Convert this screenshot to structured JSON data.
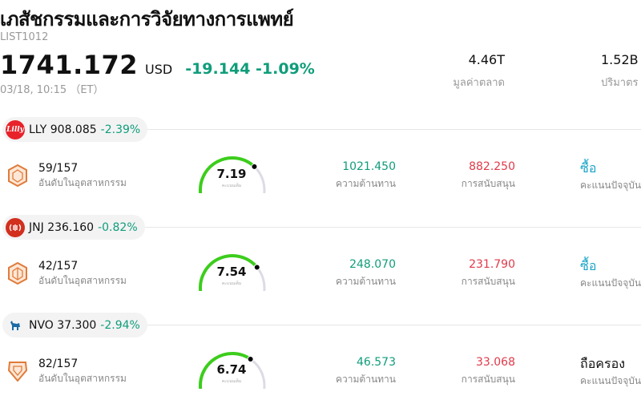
{
  "header": {
    "title": "เภสัชกรรมและการวิจัยทางการแพทย์",
    "code": "LIST1012",
    "price": "1741.172",
    "currency": "USD",
    "change": "-19.144 -1.09%",
    "timestamp": "03/18, 10:15 （ET）"
  },
  "stats": {
    "market_cap_value": "4.46T",
    "market_cap_label": "มูลค่าตลาด",
    "volume_value": "1.52B",
    "volume_label": "ปริมาตร"
  },
  "colors": {
    "positive_accent": "#0f9d7a",
    "support_red": "#e03a4a",
    "buy_cyan": "#1aa4c8",
    "gauge_green": "#3ccd1c",
    "gauge_track": "#dcdce6",
    "badge_orange": "#e07b39"
  },
  "labels": {
    "rank_label": "อันดับในอุตสาหกรรม",
    "gauge_label": "คะแนนเต็ม",
    "resistance_label": "ความต้านทาน",
    "support_label": "การสนับสนุน",
    "rating_label": "คะแนนปัจจุบัน"
  },
  "stocks": [
    {
      "ticker": "LLY",
      "price": "908.085",
      "change": "-2.39%",
      "logo_icon": "lilly-logo-icon",
      "logo_text": "Lilly",
      "rank": "59/157",
      "score": "7.19",
      "score_fraction": 0.719,
      "resistance": "1021.450",
      "support": "882.250",
      "rating": "ซื้อ"
    },
    {
      "ticker": "JNJ",
      "price": "236.160",
      "change": "-0.82%",
      "logo_icon": "jnj-logo-icon",
      "logo_text": "(||·)",
      "rank": "42/157",
      "score": "7.54",
      "score_fraction": 0.754,
      "resistance": "248.070",
      "support": "231.790",
      "rating": "ซื้อ"
    },
    {
      "ticker": "NVO",
      "price": "37.300",
      "change": "-2.94%",
      "logo_icon": "novo-bull-logo-icon",
      "logo_text": "🐂",
      "rank": "82/157",
      "score": "6.74",
      "score_fraction": 0.674,
      "resistance": "46.573",
      "support": "33.068",
      "rating": "ถือครอง"
    }
  ]
}
